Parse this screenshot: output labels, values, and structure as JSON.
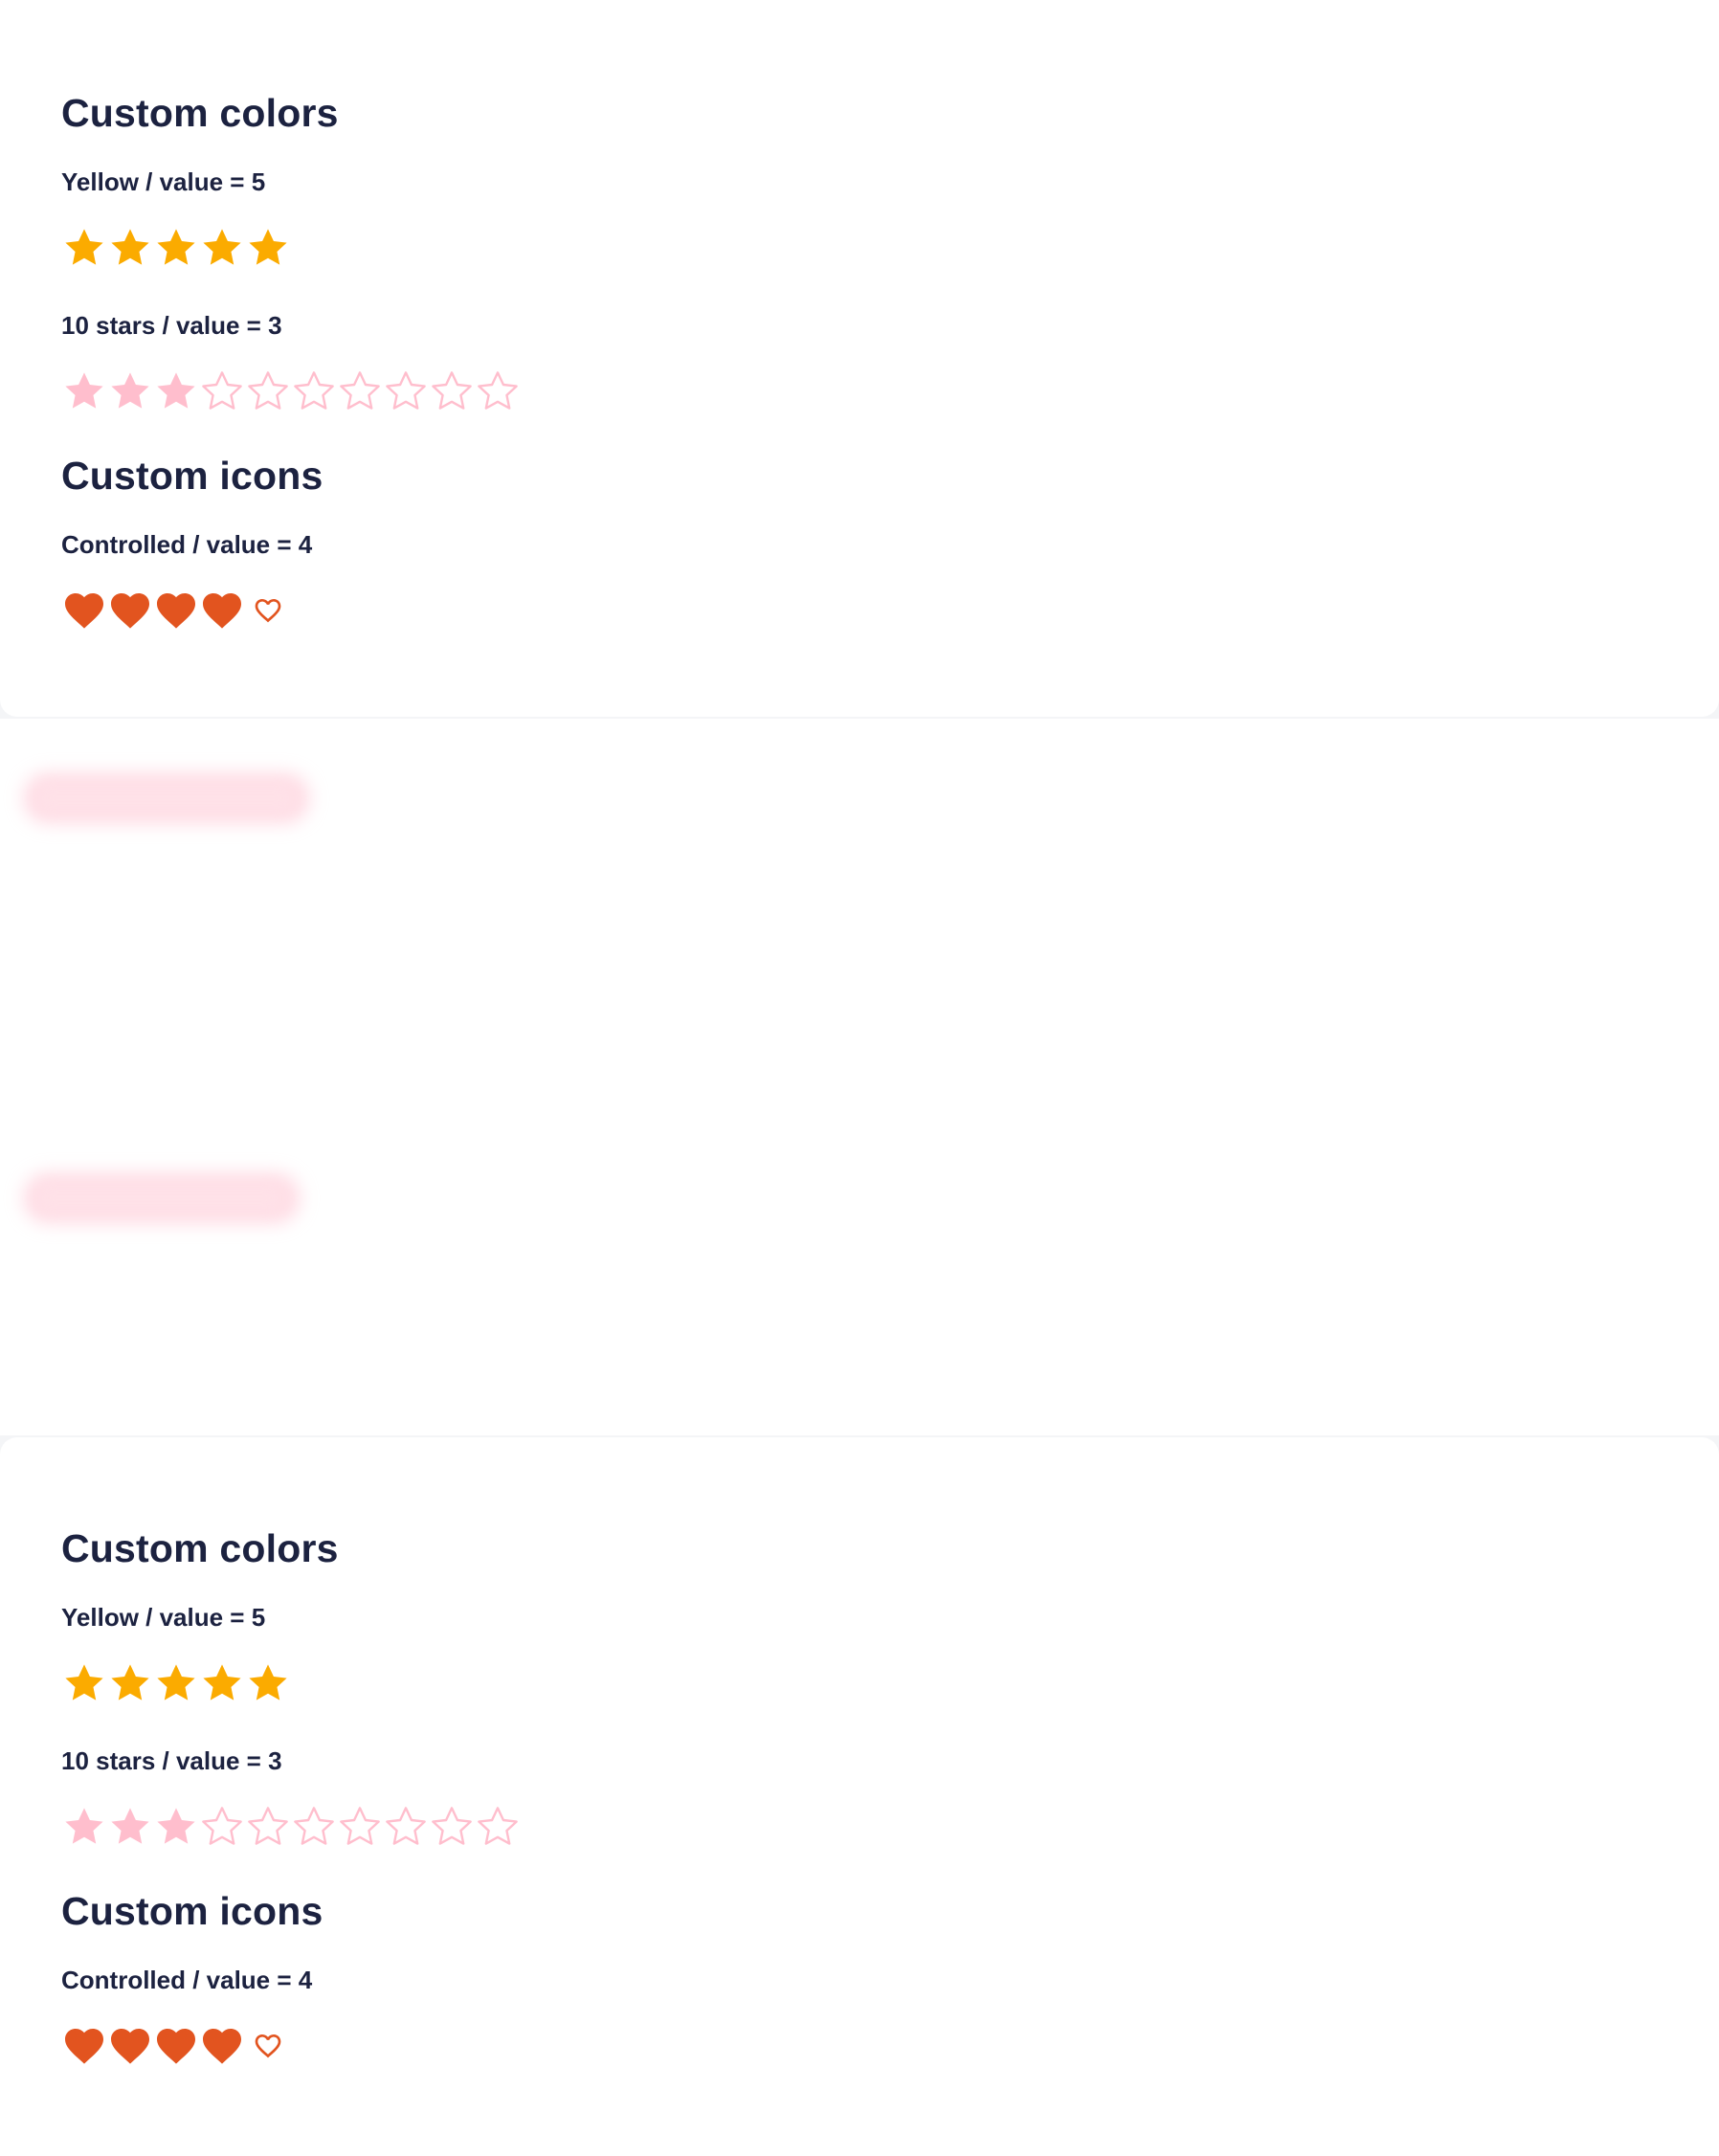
{
  "colors": {
    "yellow_star": "#fbab00",
    "pink_star": "#ffbecd",
    "heart": "#e2541f",
    "text": "#1c2240"
  },
  "top": {
    "custom_colors": {
      "title": "Custom colors",
      "yellow": {
        "label": "Yellow / value = 5",
        "value": 5,
        "max": 5,
        "icon": "star-icon"
      },
      "ten_stars": {
        "label": "10 stars / value = 3",
        "value": 3,
        "max": 10,
        "icon": "star-icon"
      }
    },
    "custom_icons": {
      "title": "Custom icons",
      "controlled": {
        "label": "Controlled / value = 4",
        "value": 4,
        "max": 5,
        "icon": "heart-icon"
      }
    }
  },
  "bottom": {
    "custom_colors": {
      "title": "Custom colors",
      "yellow": {
        "label": "Yellow / value = 5",
        "value": 5,
        "max": 5,
        "icon": "star-icon"
      },
      "ten_stars": {
        "label": "10 stars / value = 3",
        "value": 3,
        "max": 10,
        "icon": "star-icon"
      }
    },
    "custom_icons": {
      "title": "Custom icons",
      "controlled": {
        "label": "Controlled / value = 4",
        "value": 4,
        "max": 5,
        "icon": "heart-icon"
      }
    }
  }
}
